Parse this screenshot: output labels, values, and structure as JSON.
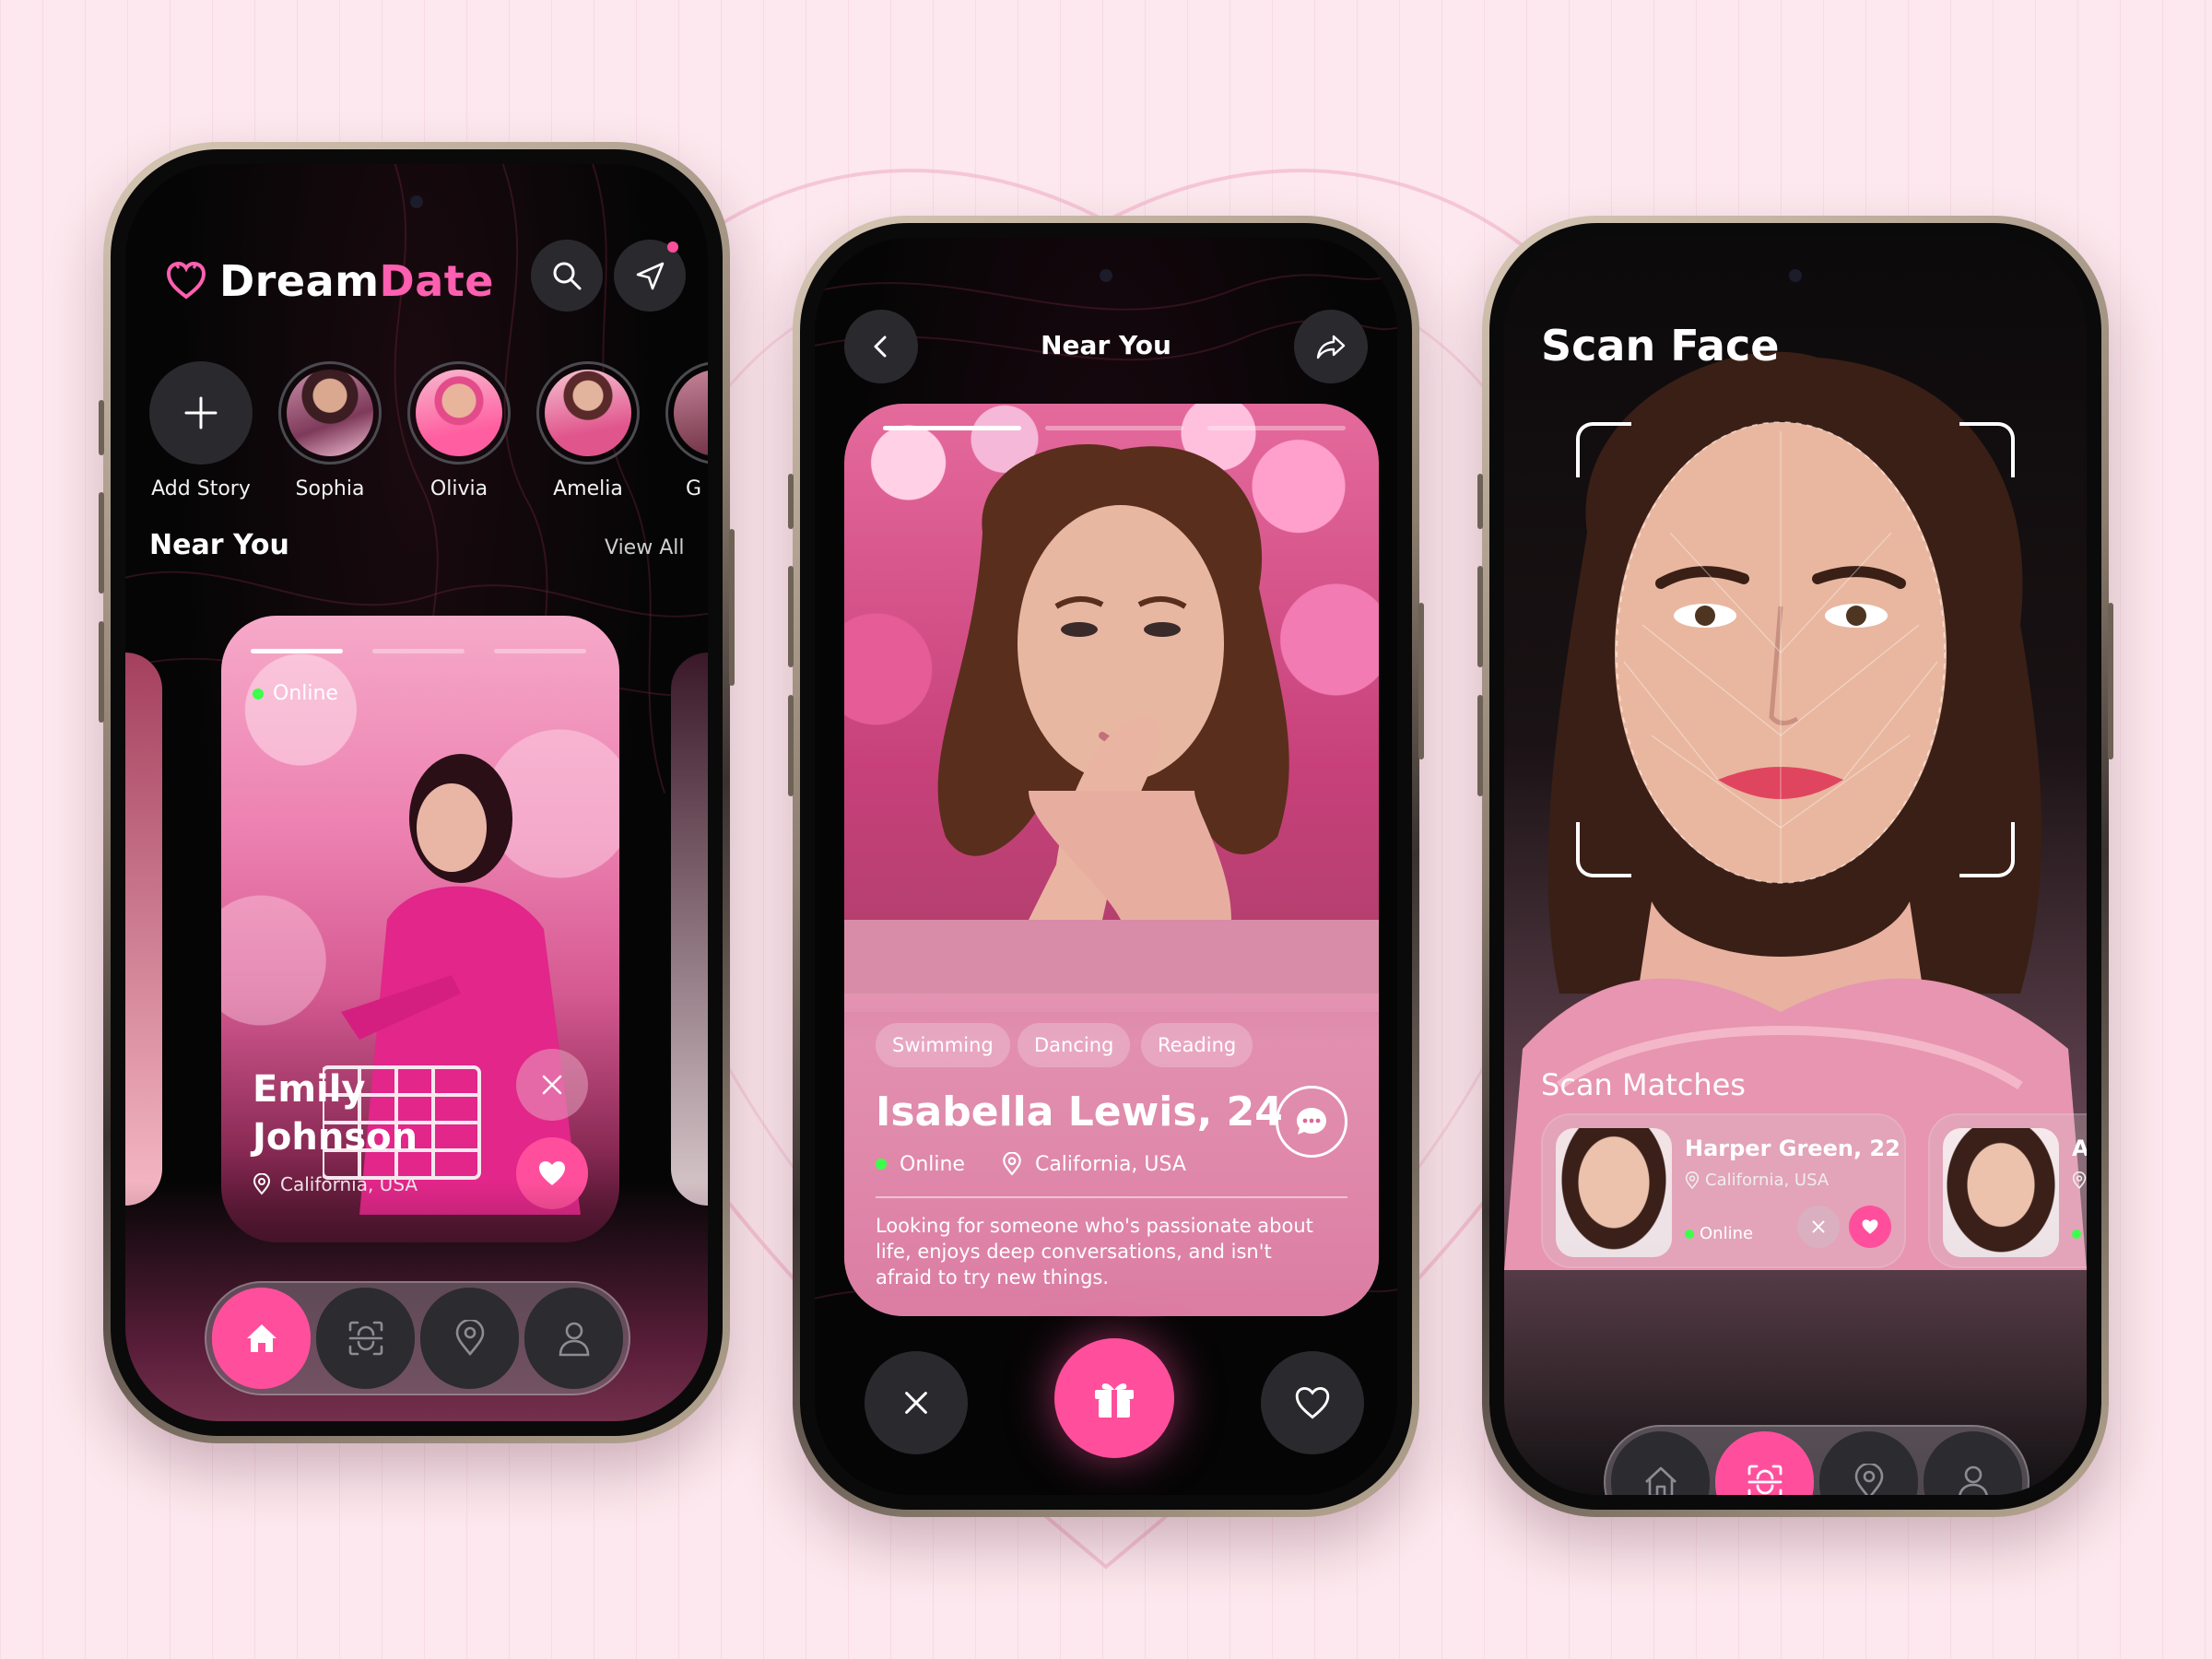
{
  "colors": {
    "accent": "#ff4f9c",
    "online": "#3cff4a",
    "background": "#fce8ee"
  },
  "phone1": {
    "logo": {
      "word1": "Dream",
      "word2": "Date",
      "icon": "heart-logo-icon"
    },
    "stories": [
      {
        "label": "Add Story"
      },
      {
        "label": "Sophia"
      },
      {
        "label": "Olivia"
      },
      {
        "label": "Amelia"
      },
      {
        "label": "G"
      }
    ],
    "section": {
      "title": "Near You",
      "action": "View All"
    },
    "card": {
      "status": "Online",
      "first_name": "Emily",
      "last_name": "Johnson",
      "location": "California, USA"
    },
    "nav": [
      "home-icon",
      "scan-face-icon",
      "location-icon",
      "profile-icon"
    ]
  },
  "phone2": {
    "header": {
      "title": "Near You"
    },
    "card": {
      "tags": [
        "Swimming",
        "Dancing",
        "Reading"
      ],
      "name": "Isabella Lewis, 24",
      "status": "Online",
      "location": "California, USA",
      "bio": "Looking for someone who's passionate about life, enjoys deep conversations, and isn't afraid to try new things."
    }
  },
  "phone3": {
    "title": "Scan Face",
    "matches_title": "Scan Matches",
    "matches": [
      {
        "name": "Harper Green, 22",
        "location": "California, USA",
        "status": "Online"
      },
      {
        "name": "Ab",
        "location": "C",
        "status": "O"
      }
    ]
  }
}
